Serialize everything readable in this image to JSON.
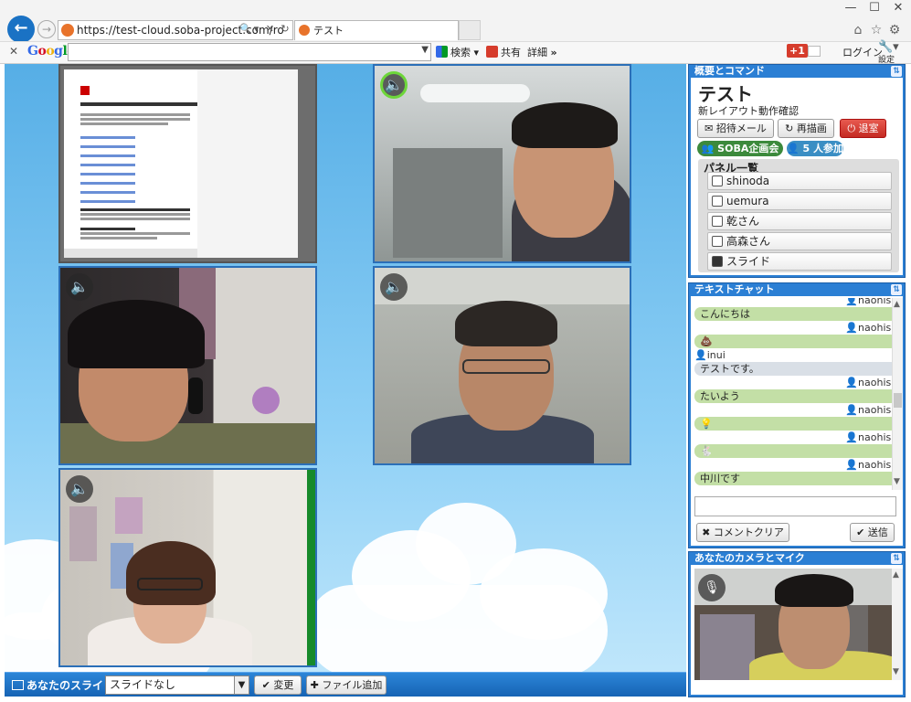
{
  "browser": {
    "url": "https://test-cloud.soba-project.com/ro",
    "tab_title": "テスト",
    "window_controls": [
      "—",
      "☐",
      "✕"
    ]
  },
  "google_toolbar": {
    "logo": "Google",
    "search_label": "検索",
    "share_label": "共有",
    "detail_label": "詳細",
    "more": "»",
    "gplus_label": "+1",
    "login_label": "ログイン",
    "settings_label": "設定"
  },
  "bottom_bar": {
    "title": "あなたのスライド",
    "slide_select_value": "スライドなし",
    "change_button": "変更",
    "add_file_button": "ファイル追加"
  },
  "summary_panel": {
    "header": "概要とコマンド",
    "title": "テスト",
    "subtitle": "新レイアウト動作確認",
    "invite_button": "招待メール",
    "redraw_button": "再描画",
    "leave_button": "退室",
    "room_badge": "SOBA企画会議",
    "participants_badge": "5 人参加",
    "panel_list_title": "パネル一覧",
    "panel_items": [
      {
        "label": "shinoda",
        "icon": "user-icon"
      },
      {
        "label": "uemura",
        "icon": "user-icon"
      },
      {
        "label": "乾さん",
        "icon": "user-icon"
      },
      {
        "label": "高森さん",
        "icon": "user-icon"
      },
      {
        "label": "スライド",
        "icon": "image-icon"
      }
    ]
  },
  "chat_panel": {
    "header": "テキストチャット",
    "messages": [
      {
        "user": "naohisa",
        "text": "こんにちは",
        "side": "right"
      },
      {
        "user": "naohisa",
        "text": "💩",
        "side": "right"
      },
      {
        "user": "inui",
        "text": "テストです。",
        "side": "left"
      },
      {
        "user": "naohisa",
        "text": "たいよう",
        "side": "right"
      },
      {
        "user": "naohisa",
        "text": "💡",
        "side": "right"
      },
      {
        "user": "naohisa",
        "text": "🐇",
        "side": "right"
      },
      {
        "user": "naohisa",
        "text": "中川です",
        "side": "right"
      }
    ],
    "clear_button": "コメントクリア",
    "send_button": "送信"
  },
  "camera_panel": {
    "header": "あなたのカメラとマイク"
  },
  "colors": {
    "accent": "#2b7fd4",
    "leave": "#d9332c",
    "badge_green": "#3c8a3c",
    "badge_blue": "#3a8ec4",
    "chat_bubble": "#c3dfa6"
  }
}
